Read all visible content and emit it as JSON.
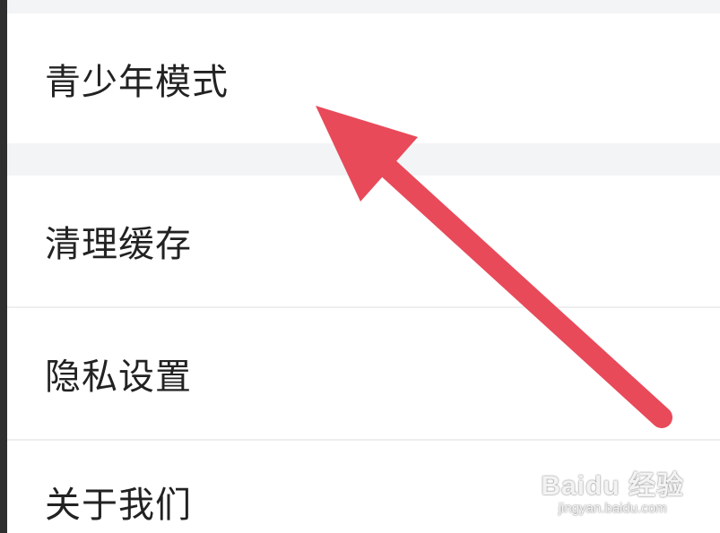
{
  "settings": {
    "items": [
      {
        "label": "青少年模式"
      },
      {
        "label": "清理缓存"
      },
      {
        "label": "隐私设置"
      },
      {
        "label": "关于我们"
      }
    ]
  },
  "annotation": {
    "arrow_color": "#e84a5a",
    "arrow_target": "青少年模式"
  },
  "watermark": {
    "brand": "Baidu 经验",
    "url": "jingyan.baidu.com"
  },
  "colors": {
    "background": "#f3f4f6",
    "row": "#ffffff",
    "text": "#222222",
    "left_edge": "#2f2f2f"
  }
}
